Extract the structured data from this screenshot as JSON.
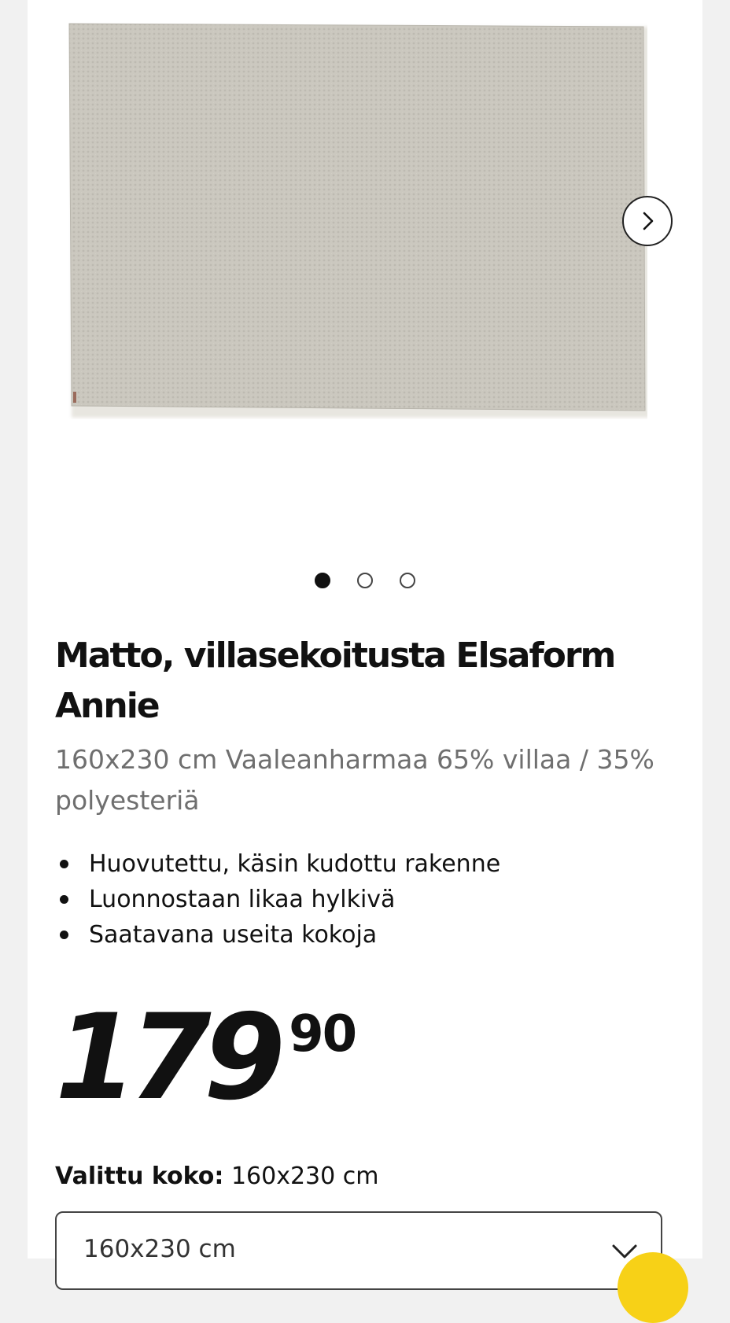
{
  "product": {
    "title": "Matto, villasekoitusta Elsaform Annie",
    "subtitle": "160x230 cm Vaaleanharmaa 65% villaa / 35% polyesteriä",
    "features": [
      "Huovutettu, käsin kudottu rakenne",
      "Luonnostaan likaa hylkivä",
      "Saatavana useita kokoja"
    ]
  },
  "gallery": {
    "image_count": 3,
    "active_index": 0,
    "next_icon": "chevron-right-icon",
    "rug_color": "#c9c6bd"
  },
  "price": {
    "integer": "179",
    "decimals": "90"
  },
  "size": {
    "label": "Valittu koko:",
    "selected": "160x230 cm",
    "select_value": "160x230 cm",
    "select_icon": "chevron-down-icon"
  },
  "colors": {
    "page_bg": "#f1f1f1",
    "card_bg": "#ffffff",
    "text": "#111111",
    "muted_text": "#6f6f6f",
    "accent_yellow": "#f7d117"
  }
}
